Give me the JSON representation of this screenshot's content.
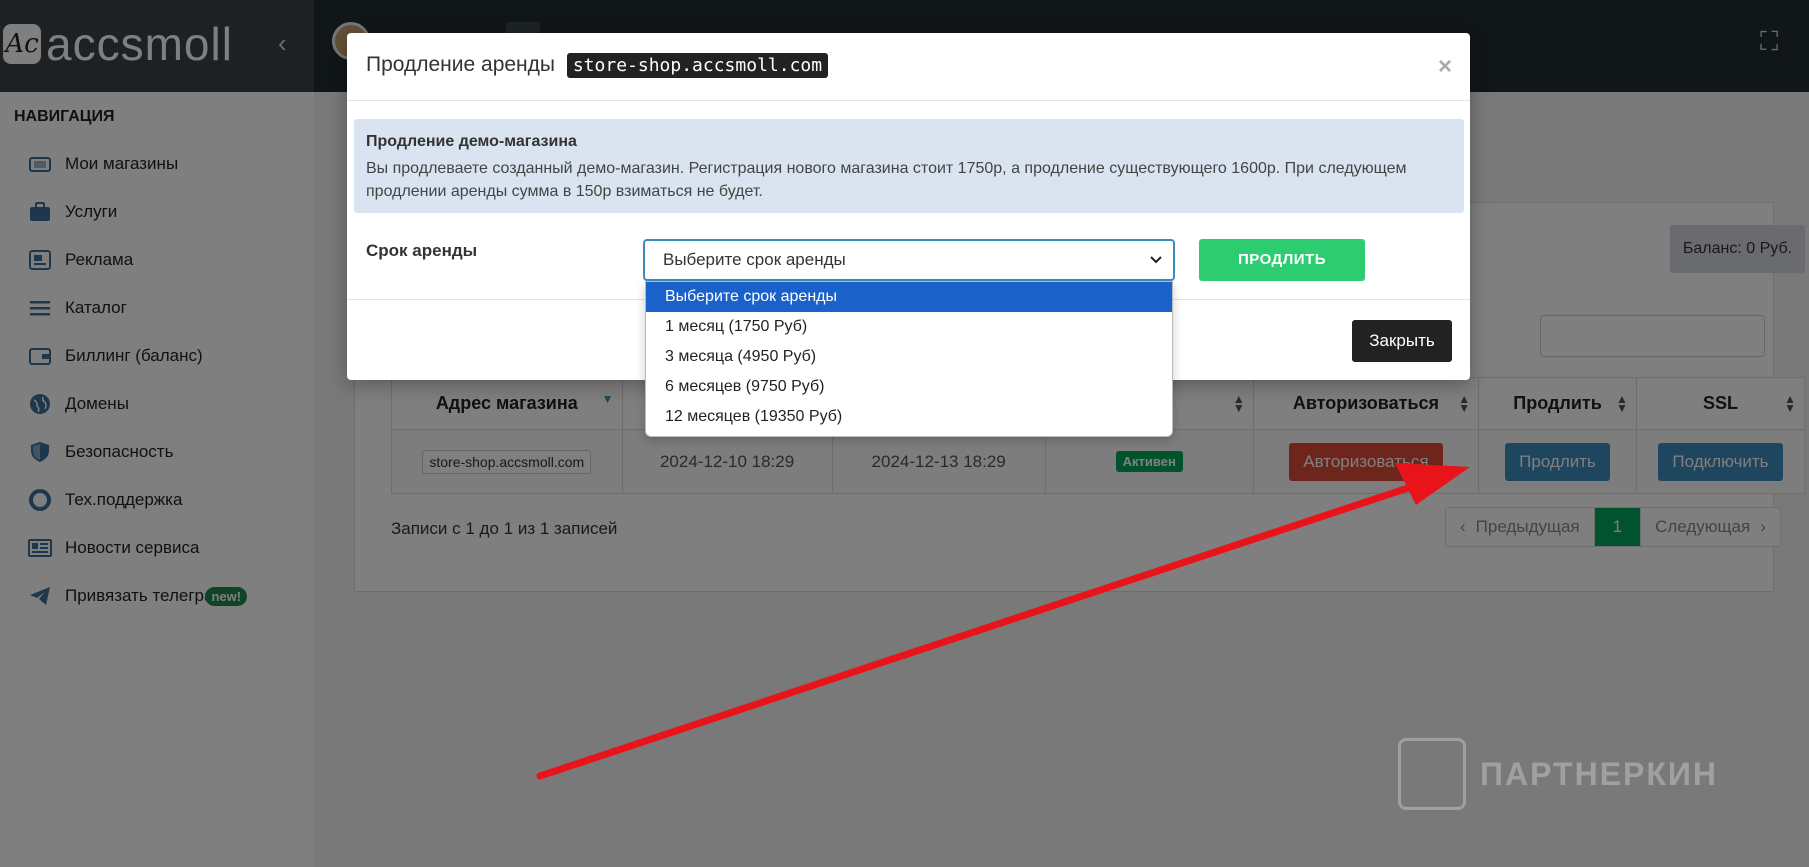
{
  "brand": {
    "logo_mark": "Ac",
    "name": "accsmoll"
  },
  "topbar": {
    "collapse_icon": "‹",
    "fullscreen_icon": "⛶"
  },
  "sidebar": {
    "header": "НАВИГАЦИЯ",
    "items": [
      {
        "label": "Мои магазины",
        "icon": "store-icon"
      },
      {
        "label": "Услуги",
        "icon": "briefcase-icon"
      },
      {
        "label": "Реклама",
        "icon": "ad-icon"
      },
      {
        "label": "Каталог",
        "icon": "list-icon"
      },
      {
        "label": "Биллинг (баланс)",
        "icon": "wallet-icon"
      },
      {
        "label": "Домены",
        "icon": "globe-icon"
      },
      {
        "label": "Безопасность",
        "icon": "shield-icon"
      },
      {
        "label": "Тех.поддержка",
        "icon": "lifebuoy-icon"
      },
      {
        "label": "Новости сервиса",
        "icon": "newspaper-icon"
      },
      {
        "label": "Привязать телегра",
        "icon": "telegram-icon",
        "badge": "new!"
      }
    ]
  },
  "main": {
    "balance": "Баланс: 0 Руб.",
    "table": {
      "headers": [
        "Адрес магазина",
        "",
        "",
        "",
        "Авторизоваться",
        "Продлить",
        "SSL"
      ],
      "row": {
        "address": "store-shop.accsmoll.com",
        "created": "2024-12-10 18:29",
        "expires": "2024-12-13 18:29",
        "status": "Активен",
        "auth_button": "Авторизоваться",
        "extend_button": "Продлить",
        "ssl_button": "Подключить"
      }
    },
    "records_info": "Записи с 1 до 1 из 1 записей",
    "pagination": {
      "prev": "Предыдущая",
      "current": "1",
      "next": "Следующая",
      "prev_icon": "‹",
      "next_icon": "›"
    }
  },
  "modal": {
    "title": "Продление аренды",
    "domain": "store-shop.accsmoll.com",
    "close_icon": "×",
    "info_title": "Продление демо-магазина",
    "info_text": "Вы продлеваете созданный демо-магазин. Регистрация нового магазина стоит 1750р, а продление существующего 1600р. При следующем продлении аренды сумма в 150р взиматься не будет.",
    "term_label": "Срок аренды",
    "select_value": "Выберите срок аренды",
    "extend_button": "ПРОДЛИТЬ",
    "close_button": "Закрыть",
    "options": [
      "Выберите срок аренды",
      "1 месяц (1750 Руб)",
      "3 месяца (4950 Руб)",
      "6 месяцев (9750 Руб)",
      "12 месяцев (19350 Руб)"
    ],
    "selected_option": 0
  },
  "watermark": {
    "text": "ПАРТНЕРКИН"
  },
  "colors": {
    "accent": "#3c8dbc",
    "success": "#00a65a",
    "danger": "#dd4b39",
    "extend": "#2ecc71",
    "annotation_arrow": "#e8141a",
    "dropdown_highlight": "#1a62c9"
  }
}
